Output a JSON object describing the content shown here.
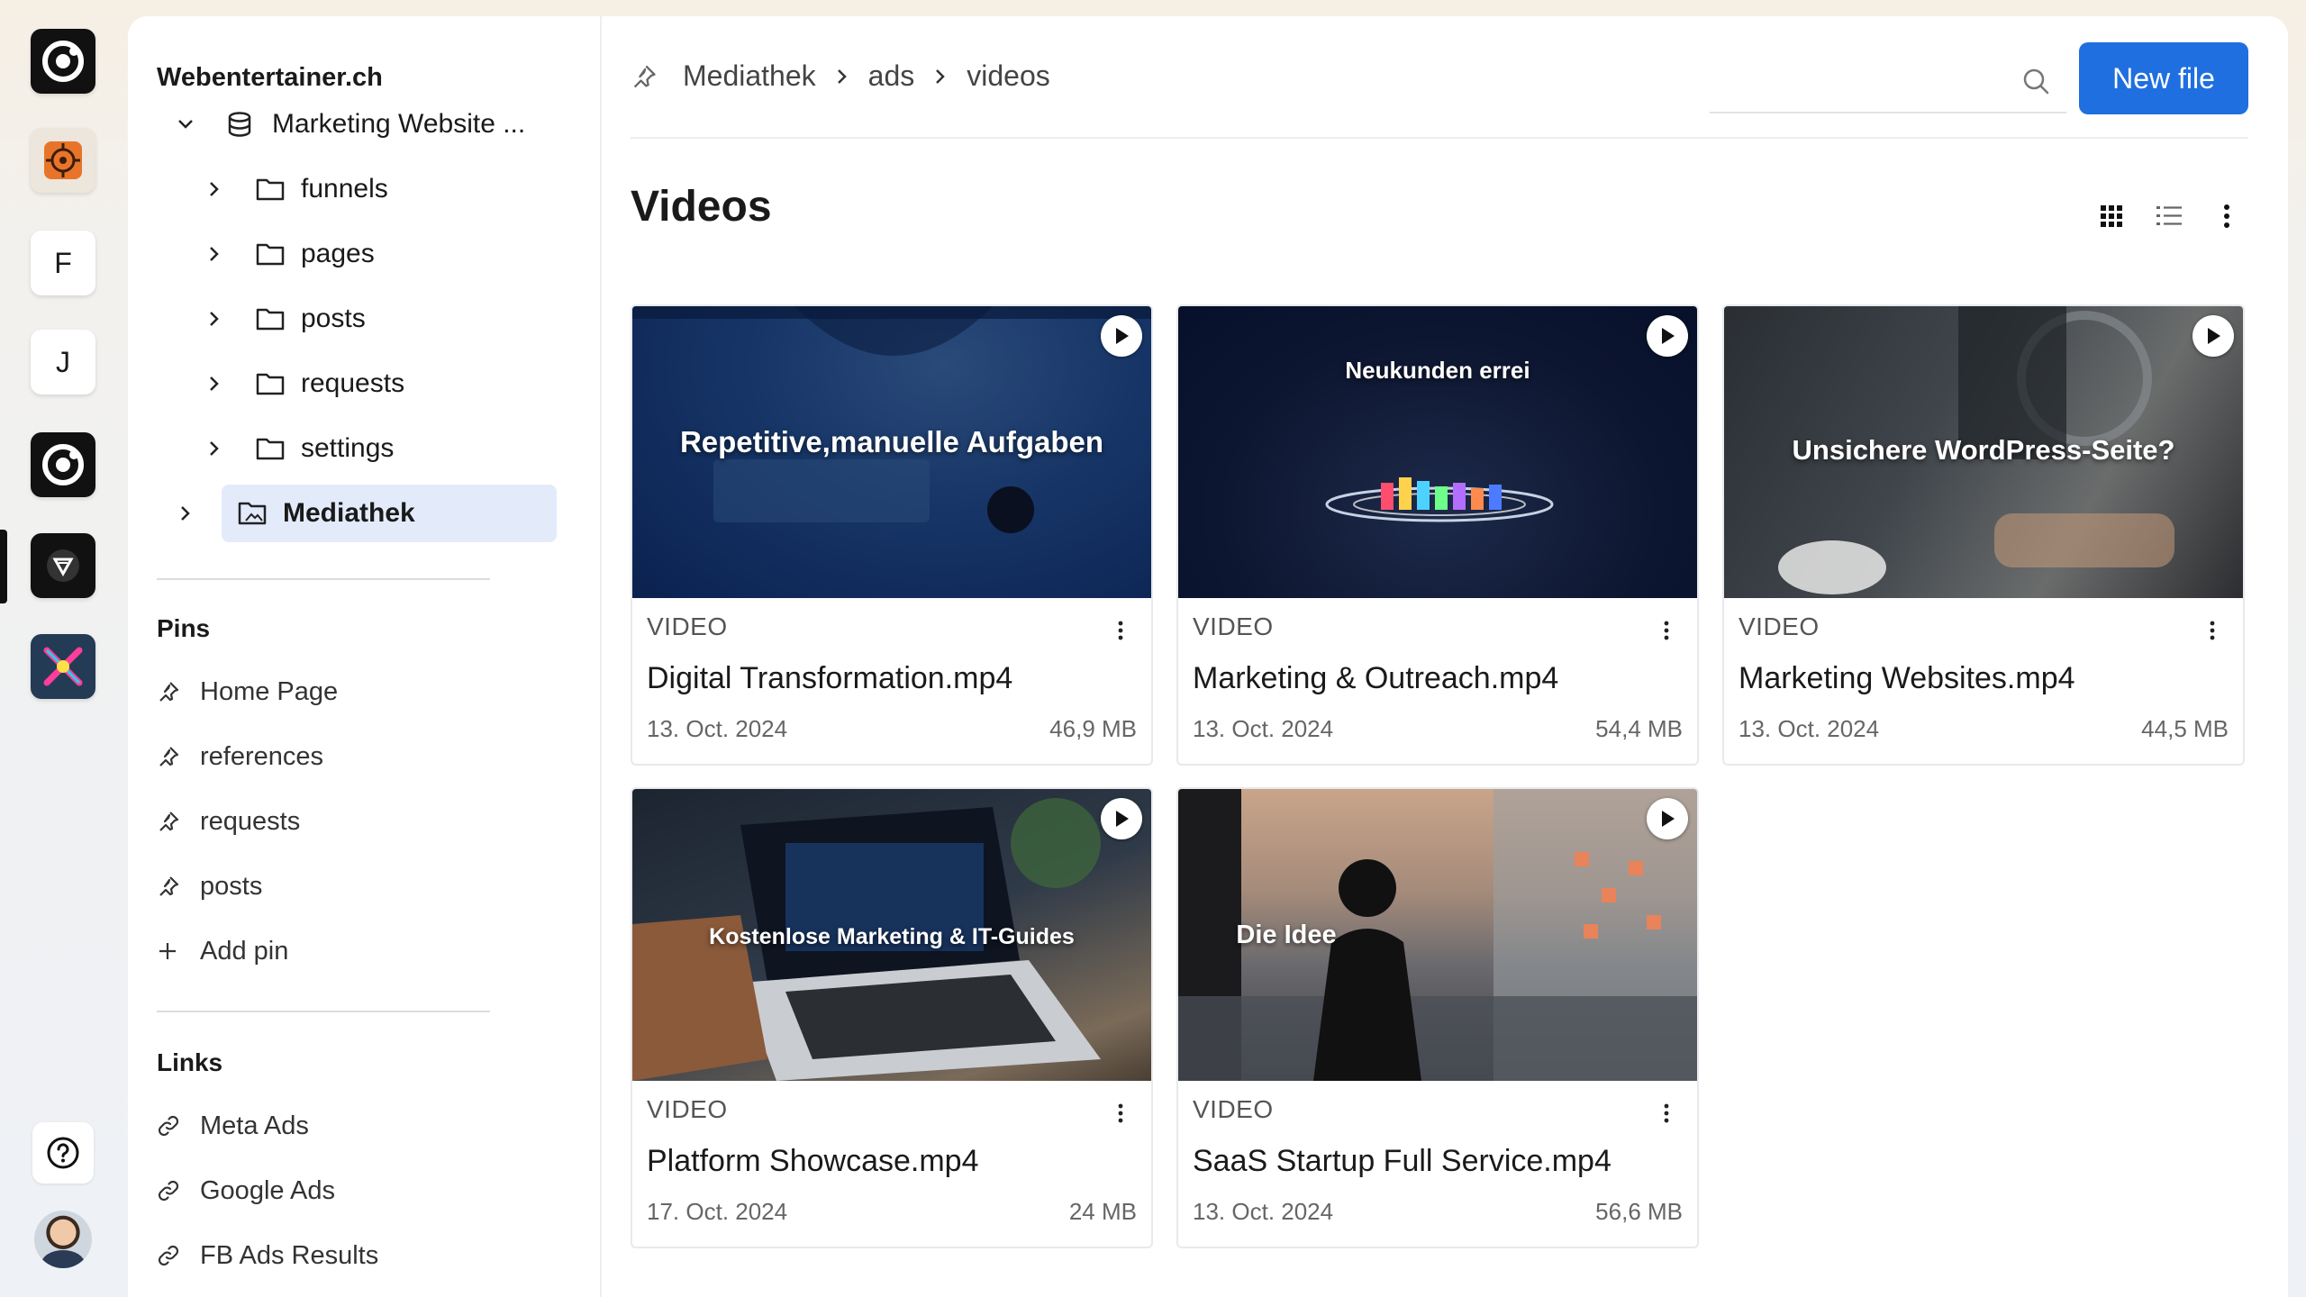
{
  "rail": {
    "apps": [
      {
        "name": "app-ring",
        "letter": ""
      },
      {
        "name": "app-orange",
        "letter": ""
      },
      {
        "name": "app-f",
        "letter": "F"
      },
      {
        "name": "app-j",
        "letter": "J"
      },
      {
        "name": "app-ring-2",
        "letter": ""
      },
      {
        "name": "app-triangle",
        "letter": ""
      },
      {
        "name": "app-colorful",
        "letter": ""
      }
    ]
  },
  "sidebar": {
    "workspace": "Webentertainer.ch",
    "project": "Marketing Website ...",
    "folders": [
      "funnels",
      "pages",
      "posts",
      "requests",
      "settings"
    ],
    "selected": "Mediathek",
    "pins_title": "Pins",
    "pins": [
      "Home Page",
      "references",
      "requests",
      "posts"
    ],
    "add_pin": "Add pin",
    "links_title": "Links",
    "links": [
      "Meta Ads",
      "Google Ads",
      "FB Ads Results"
    ]
  },
  "header": {
    "breadcrumb": [
      "Mediathek",
      "ads",
      "videos"
    ],
    "search_placeholder": "",
    "new_file": "New file"
  },
  "page": {
    "title": "Videos"
  },
  "videos": [
    {
      "kind": "VIDEO",
      "name": "Digital Transformation.mp4",
      "date": "13. Oct. 2024",
      "size": "46,9 MB",
      "caption": "Repetitive,manuelle Aufgaben"
    },
    {
      "kind": "VIDEO",
      "name": "Marketing & Outreach.mp4",
      "date": "13. Oct. 2024",
      "size": "54,4 MB",
      "caption": "Neukunden errei"
    },
    {
      "kind": "VIDEO",
      "name": "Marketing Websites.mp4",
      "date": "13. Oct. 2024",
      "size": "44,5 MB",
      "caption": "Unsichere WordPress-Seite?"
    },
    {
      "kind": "VIDEO",
      "name": "Platform Showcase.mp4",
      "date": "17. Oct. 2024",
      "size": "24 MB",
      "caption": "Kostenlose Marketing & IT-Guides"
    },
    {
      "kind": "VIDEO",
      "name": "SaaS Startup Full Service.mp4",
      "date": "13. Oct. 2024",
      "size": "56,6 MB",
      "caption": "Die Idee"
    }
  ],
  "colors": {
    "accent": "#1f6fe0",
    "selected_bg": "#e3ebfb"
  }
}
